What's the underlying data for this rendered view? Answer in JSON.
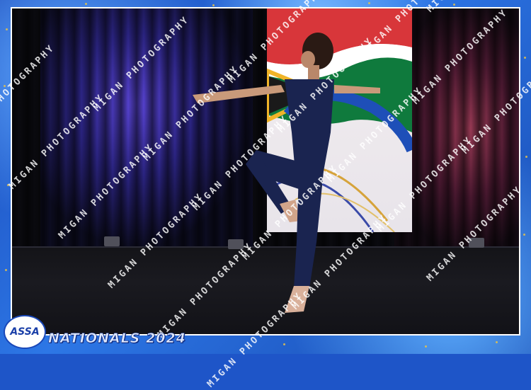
{
  "event": {
    "title": "NATIONALS 2024",
    "logo_text": "ASSA"
  },
  "watermark": {
    "text": "MIGAN PHOTOGRAPHY"
  },
  "colors": {
    "frame_blue": "#1e55c8",
    "curtain_blue_light": "#5a45d6",
    "curtain_red_light": "#9a3a55",
    "costume_navy": "#1a2450",
    "gold_flakes": "#e6c24a"
  }
}
